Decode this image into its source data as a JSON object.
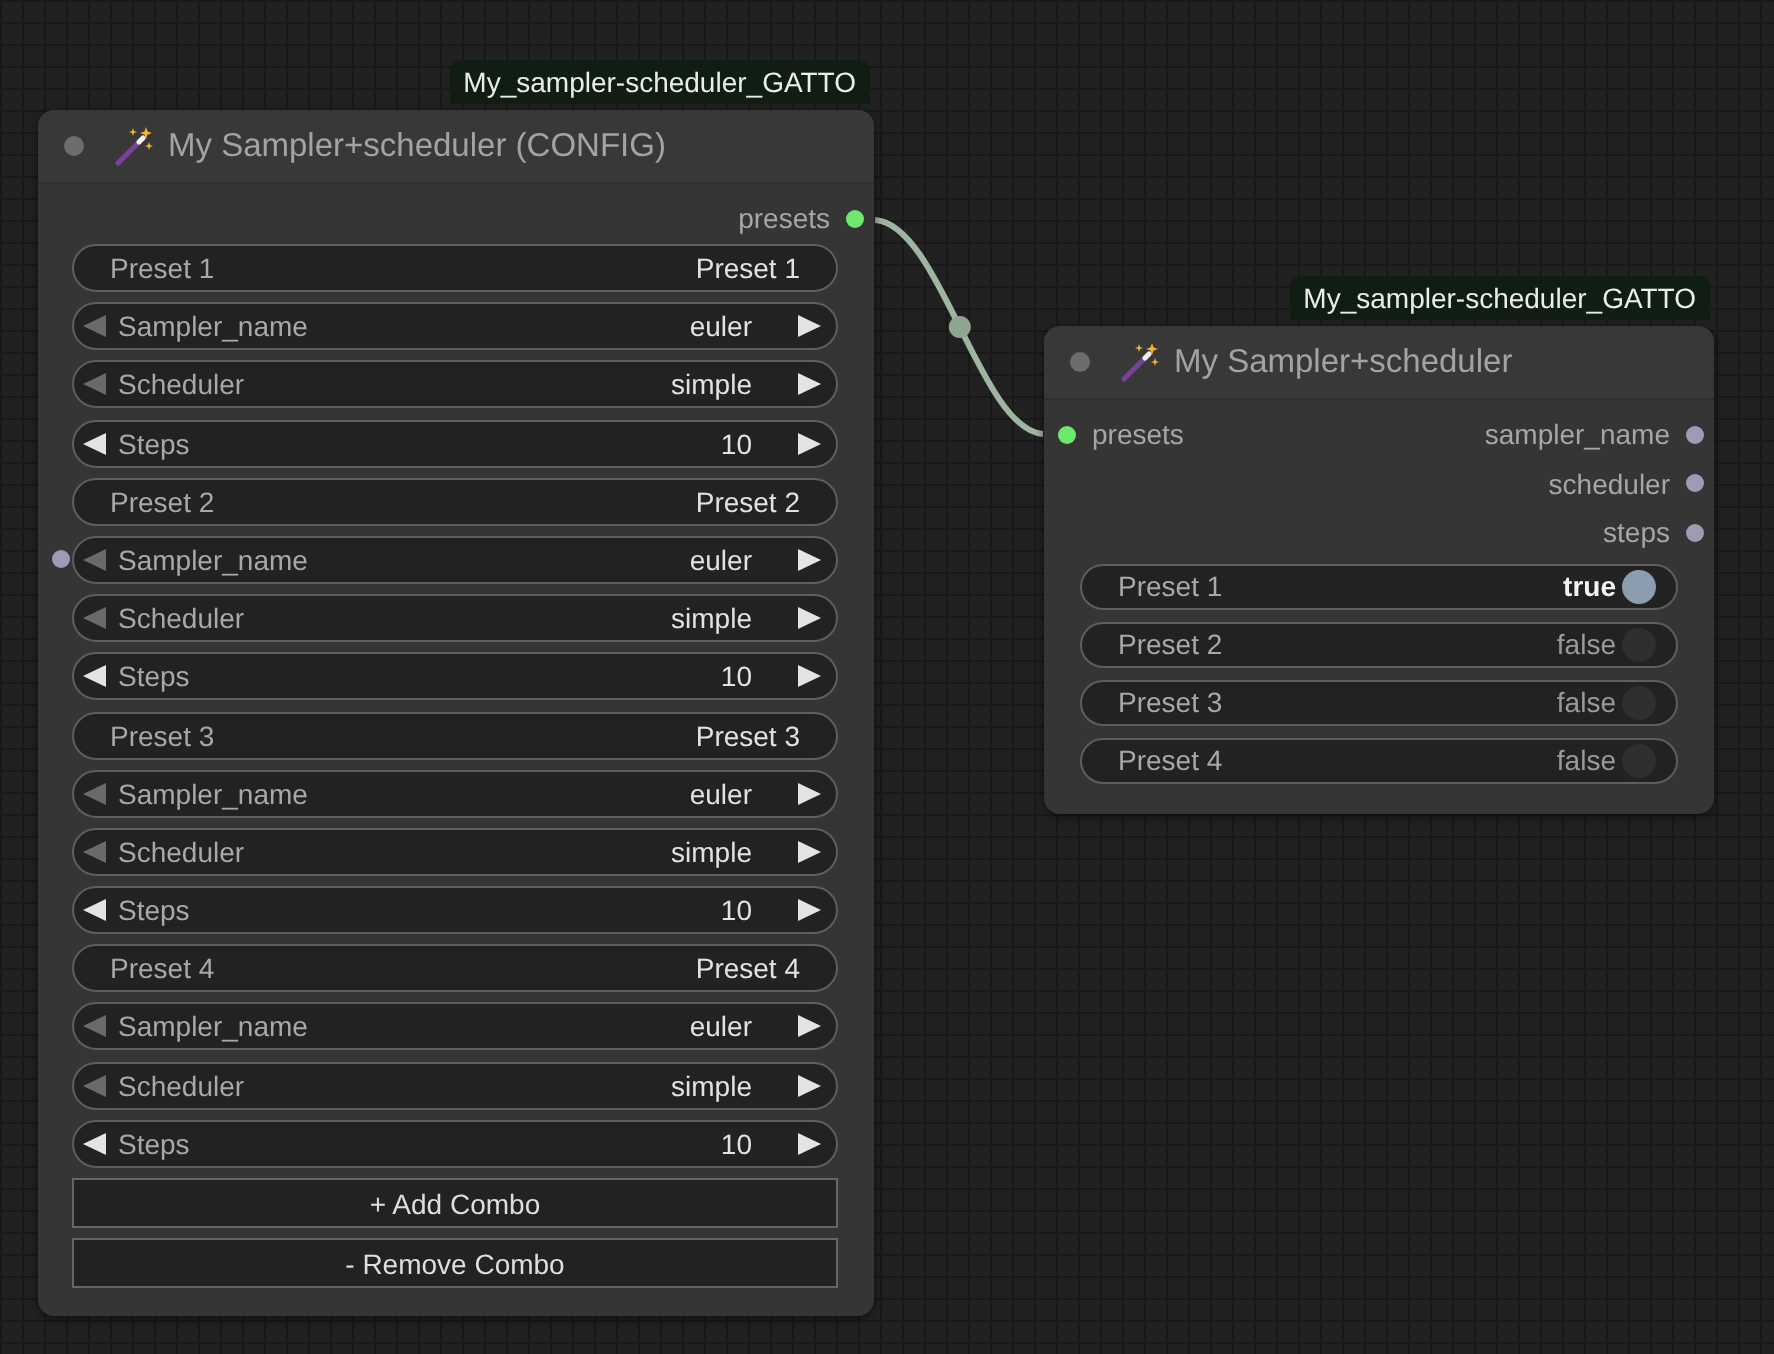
{
  "config_node": {
    "badge": "My_sampler-scheduler_GATTO",
    "title": "My Sampler+scheduler (CONFIG)",
    "outputs": [
      {
        "name": "presets",
        "color": "#6ce86c"
      }
    ],
    "widgets": [
      {
        "kind": "text",
        "label": "Preset 1",
        "value": "Preset 1",
        "input_socket": false
      },
      {
        "kind": "stepper",
        "label": "Sampler_name",
        "value": "euler",
        "prev_disabled": true,
        "input_socket": false
      },
      {
        "kind": "stepper",
        "label": "Scheduler",
        "value": "simple",
        "prev_disabled": true,
        "input_socket": false
      },
      {
        "kind": "stepper",
        "label": "Steps",
        "value": "10",
        "prev_disabled": false,
        "input_socket": false
      },
      {
        "kind": "text",
        "label": "Preset 2",
        "value": "Preset 2",
        "input_socket": false
      },
      {
        "kind": "stepper",
        "label": "Sampler_name",
        "value": "euler",
        "prev_disabled": true,
        "input_socket": true
      },
      {
        "kind": "stepper",
        "label": "Scheduler",
        "value": "simple",
        "prev_disabled": true,
        "input_socket": false
      },
      {
        "kind": "stepper",
        "label": "Steps",
        "value": "10",
        "prev_disabled": false,
        "input_socket": false
      },
      {
        "kind": "text",
        "label": "Preset 3",
        "value": "Preset 3",
        "input_socket": false
      },
      {
        "kind": "stepper",
        "label": "Sampler_name",
        "value": "euler",
        "prev_disabled": true,
        "input_socket": false
      },
      {
        "kind": "stepper",
        "label": "Scheduler",
        "value": "simple",
        "prev_disabled": true,
        "input_socket": false
      },
      {
        "kind": "stepper",
        "label": "Steps",
        "value": "10",
        "prev_disabled": false,
        "input_socket": false
      },
      {
        "kind": "text",
        "label": "Preset 4",
        "value": "Preset 4",
        "input_socket": false
      },
      {
        "kind": "stepper",
        "label": "Sampler_name",
        "value": "euler",
        "prev_disabled": true,
        "input_socket": false
      },
      {
        "kind": "stepper",
        "label": "Scheduler",
        "value": "simple",
        "prev_disabled": true,
        "input_socket": false
      },
      {
        "kind": "stepper",
        "label": "Steps",
        "value": "10",
        "prev_disabled": false,
        "input_socket": false
      }
    ],
    "buttons": [
      {
        "label": "+ Add Combo"
      },
      {
        "label": "- Remove Combo"
      }
    ]
  },
  "selector_node": {
    "badge": "My_sampler-scheduler_GATTO",
    "title": "My Sampler+scheduler",
    "inputs": [
      {
        "name": "presets",
        "color": "#6ce86c"
      }
    ],
    "outputs": [
      {
        "name": "sampler_name",
        "color": "#9c9cb4"
      },
      {
        "name": "scheduler",
        "color": "#9c9cb4"
      },
      {
        "name": "steps",
        "color": "#9c9cb4"
      }
    ],
    "toggles": [
      {
        "label": "Preset 1",
        "value": "true",
        "on": true
      },
      {
        "label": "Preset 2",
        "value": "false",
        "on": false
      },
      {
        "label": "Preset 3",
        "value": "false",
        "on": false
      },
      {
        "label": "Preset 4",
        "value": "false",
        "on": false
      }
    ]
  }
}
